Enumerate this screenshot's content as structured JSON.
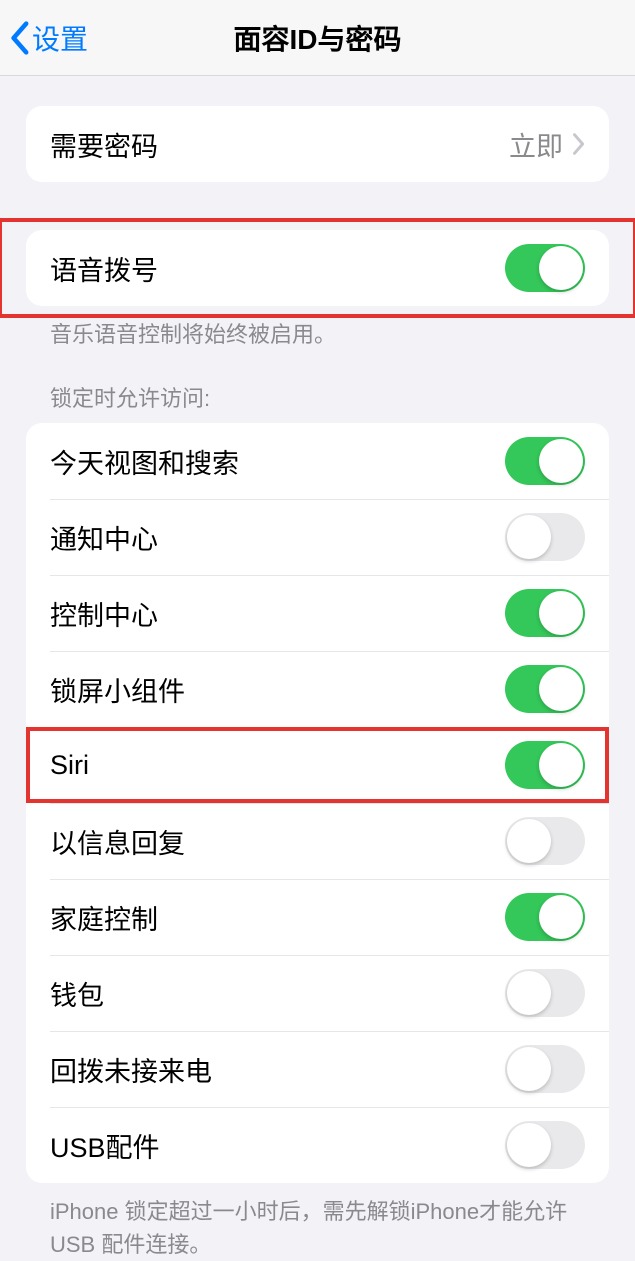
{
  "nav": {
    "back_label": "设置",
    "title": "面容ID与密码"
  },
  "require_passcode": {
    "label": "需要密码",
    "value": "立即"
  },
  "voice_dial": {
    "label": "语音拨号",
    "footer": "音乐语音控制将始终被启用。"
  },
  "lock_access": {
    "header": "锁定时允许访问:",
    "items": [
      {
        "label": "今天视图和搜索",
        "on": true
      },
      {
        "label": "通知中心",
        "on": false
      },
      {
        "label": "控制中心",
        "on": true
      },
      {
        "label": "锁屏小组件",
        "on": true
      },
      {
        "label": "Siri",
        "on": true,
        "highlight": true
      },
      {
        "label": "以信息回复",
        "on": false
      },
      {
        "label": "家庭控制",
        "on": true
      },
      {
        "label": "钱包",
        "on": false
      },
      {
        "label": "回拨未接来电",
        "on": false
      },
      {
        "label": "USB配件",
        "on": false
      }
    ],
    "footer": "iPhone 锁定超过一小时后，需先解锁iPhone才能允许USB 配件连接。"
  }
}
